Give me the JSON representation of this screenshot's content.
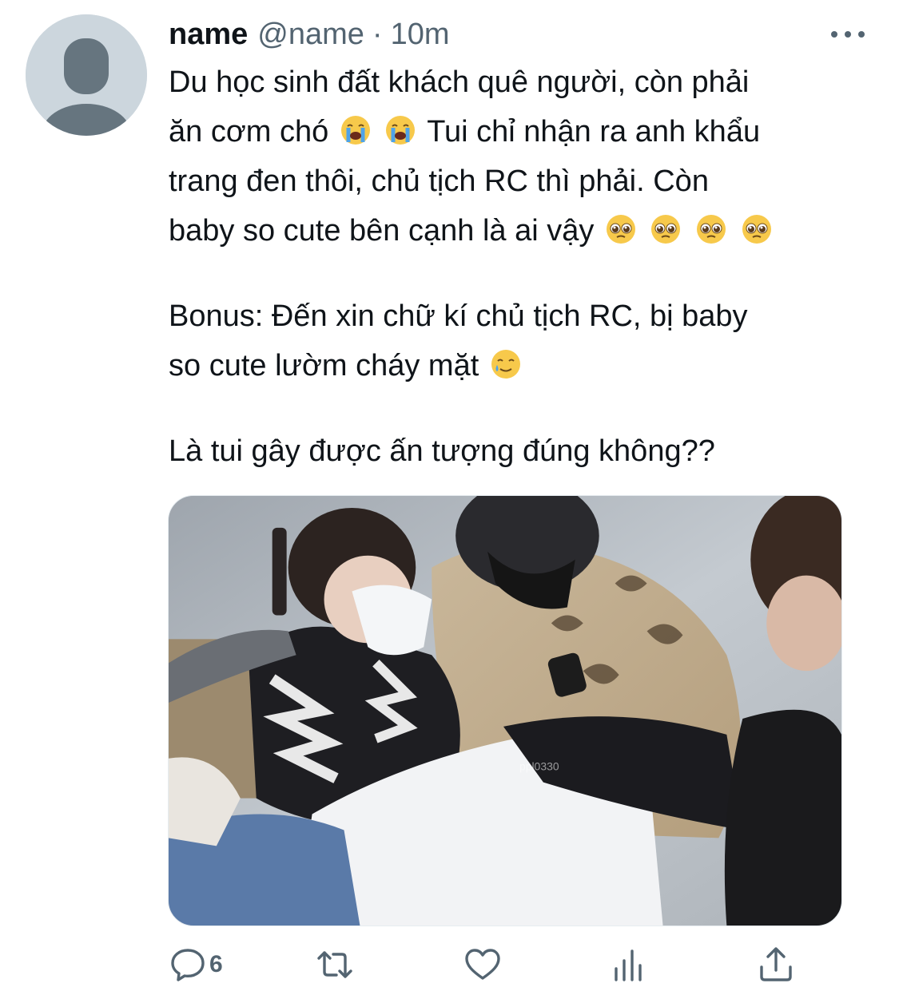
{
  "tweet": {
    "author_name": "name",
    "handle": "@name",
    "separator": "·",
    "time": "10m",
    "lines": [
      {
        "segments": [
          {
            "text": "Du học sinh đất khách quê người, còn phải"
          }
        ]
      },
      {
        "segments": [
          {
            "text": "ăn cơm chó "
          },
          {
            "emoji": "loudly-crying-face"
          },
          {
            "text": " "
          },
          {
            "emoji": "loudly-crying-face"
          },
          {
            "text": "  Tui chỉ nhận ra anh khẩu"
          }
        ]
      },
      {
        "segments": [
          {
            "text": "trang đen thôi, chủ tịch RC thì phải. Còn"
          }
        ]
      },
      {
        "segments": [
          {
            "text": "baby so cute bên cạnh là ai vậy "
          },
          {
            "emoji": "pleading-face"
          },
          {
            "text": " "
          },
          {
            "emoji": "pleading-face"
          },
          {
            "text": " "
          },
          {
            "emoji": "pleading-face"
          },
          {
            "text": " "
          },
          {
            "emoji": "pleading-face"
          }
        ]
      },
      {
        "gap": true
      },
      {
        "segments": [
          {
            "text": "Bonus: Đến xin chữ kí chủ tịch RC, bị baby"
          }
        ]
      },
      {
        "segments": [
          {
            "text": "so cute lườm cháy mặt "
          },
          {
            "emoji": "smiling-face-with-tear"
          }
        ]
      },
      {
        "gap": true
      },
      {
        "segments": [
          {
            "text": "Là tui gây được ấn tượng đúng không??"
          }
        ]
      }
    ],
    "media": {
      "description_icon": "photo",
      "watermark": "ppl0330"
    },
    "actions": {
      "reply_count": "6",
      "retweet_count": "",
      "like_count": ""
    }
  },
  "colors": {
    "text_primary": "#0f1419",
    "text_secondary": "#536471",
    "avatar_bg": "#ccd6dd",
    "avatar_fg": "#66757f",
    "emoji_yellow": "#f7c94b"
  }
}
